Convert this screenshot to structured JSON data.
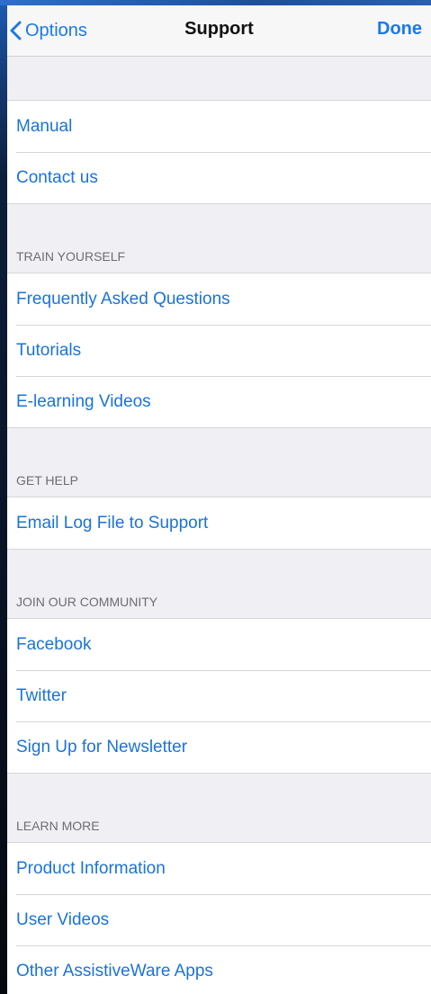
{
  "navbar": {
    "back_label": "Options",
    "title": "Support",
    "done_label": "Done"
  },
  "sections": [
    {
      "header": "",
      "items": [
        "Manual",
        "Contact us"
      ]
    },
    {
      "header": "TRAIN YOURSELF",
      "items": [
        "Frequently Asked Questions",
        "Tutorials",
        "E-learning Videos"
      ]
    },
    {
      "header": "GET HELP",
      "items": [
        "Email Log File to Support"
      ]
    },
    {
      "header": "JOIN OUR COMMUNITY",
      "items": [
        "Facebook",
        "Twitter",
        "Sign Up for Newsletter"
      ]
    },
    {
      "header": "LEARN MORE",
      "items": [
        "Product Information",
        "User Videos",
        "Other AssistiveWare Apps"
      ]
    }
  ],
  "colors": {
    "accent": "#1a73d9",
    "background": "#efeff4",
    "navbar": "#f7f7f7"
  }
}
